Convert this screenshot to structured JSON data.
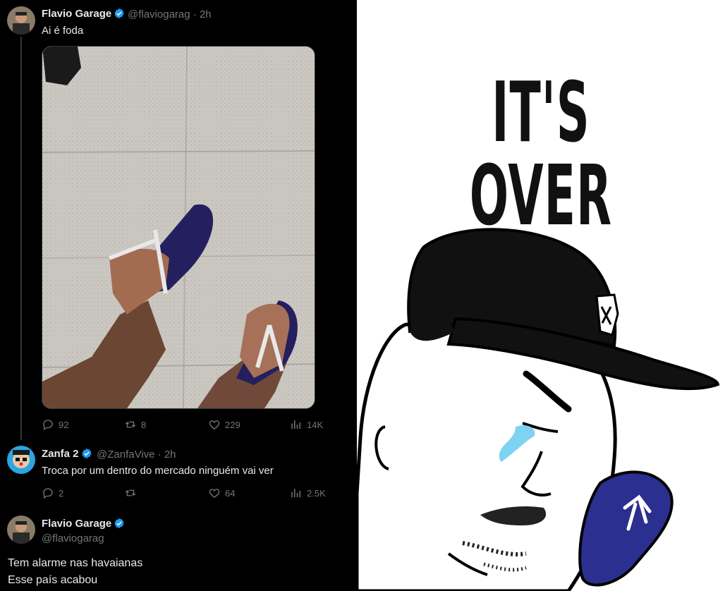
{
  "tweet1": {
    "name": "Flavio Garage",
    "handle": "@flaviogarag",
    "time": "· 2h",
    "text": "Ai é foda",
    "stats": {
      "replies": "92",
      "retweets": "8",
      "likes": "229",
      "views": "14K"
    }
  },
  "tweet2": {
    "name": "Zanfa 2",
    "handle": "@ZanfaVive",
    "time": "· 2h",
    "text": "Troca por um dentro do mercado ninguém vai ver",
    "stats": {
      "replies": "2",
      "retweets": "",
      "likes": "64",
      "views": "2.5K"
    }
  },
  "tweet3": {
    "name": "Flavio Garage",
    "handle": "@flaviogarag",
    "line1": "Tem alarme nas havaianas",
    "line2": "Esse país acabou"
  },
  "meme": {
    "title": "IT'S OVER"
  },
  "colors": {
    "background_left": "#000000",
    "text_primary": "#e7e9ea",
    "text_secondary": "#71767b",
    "verified": "#1d9bf0",
    "flipflop": "#2b2f8f",
    "tear": "#7fd3f2"
  }
}
